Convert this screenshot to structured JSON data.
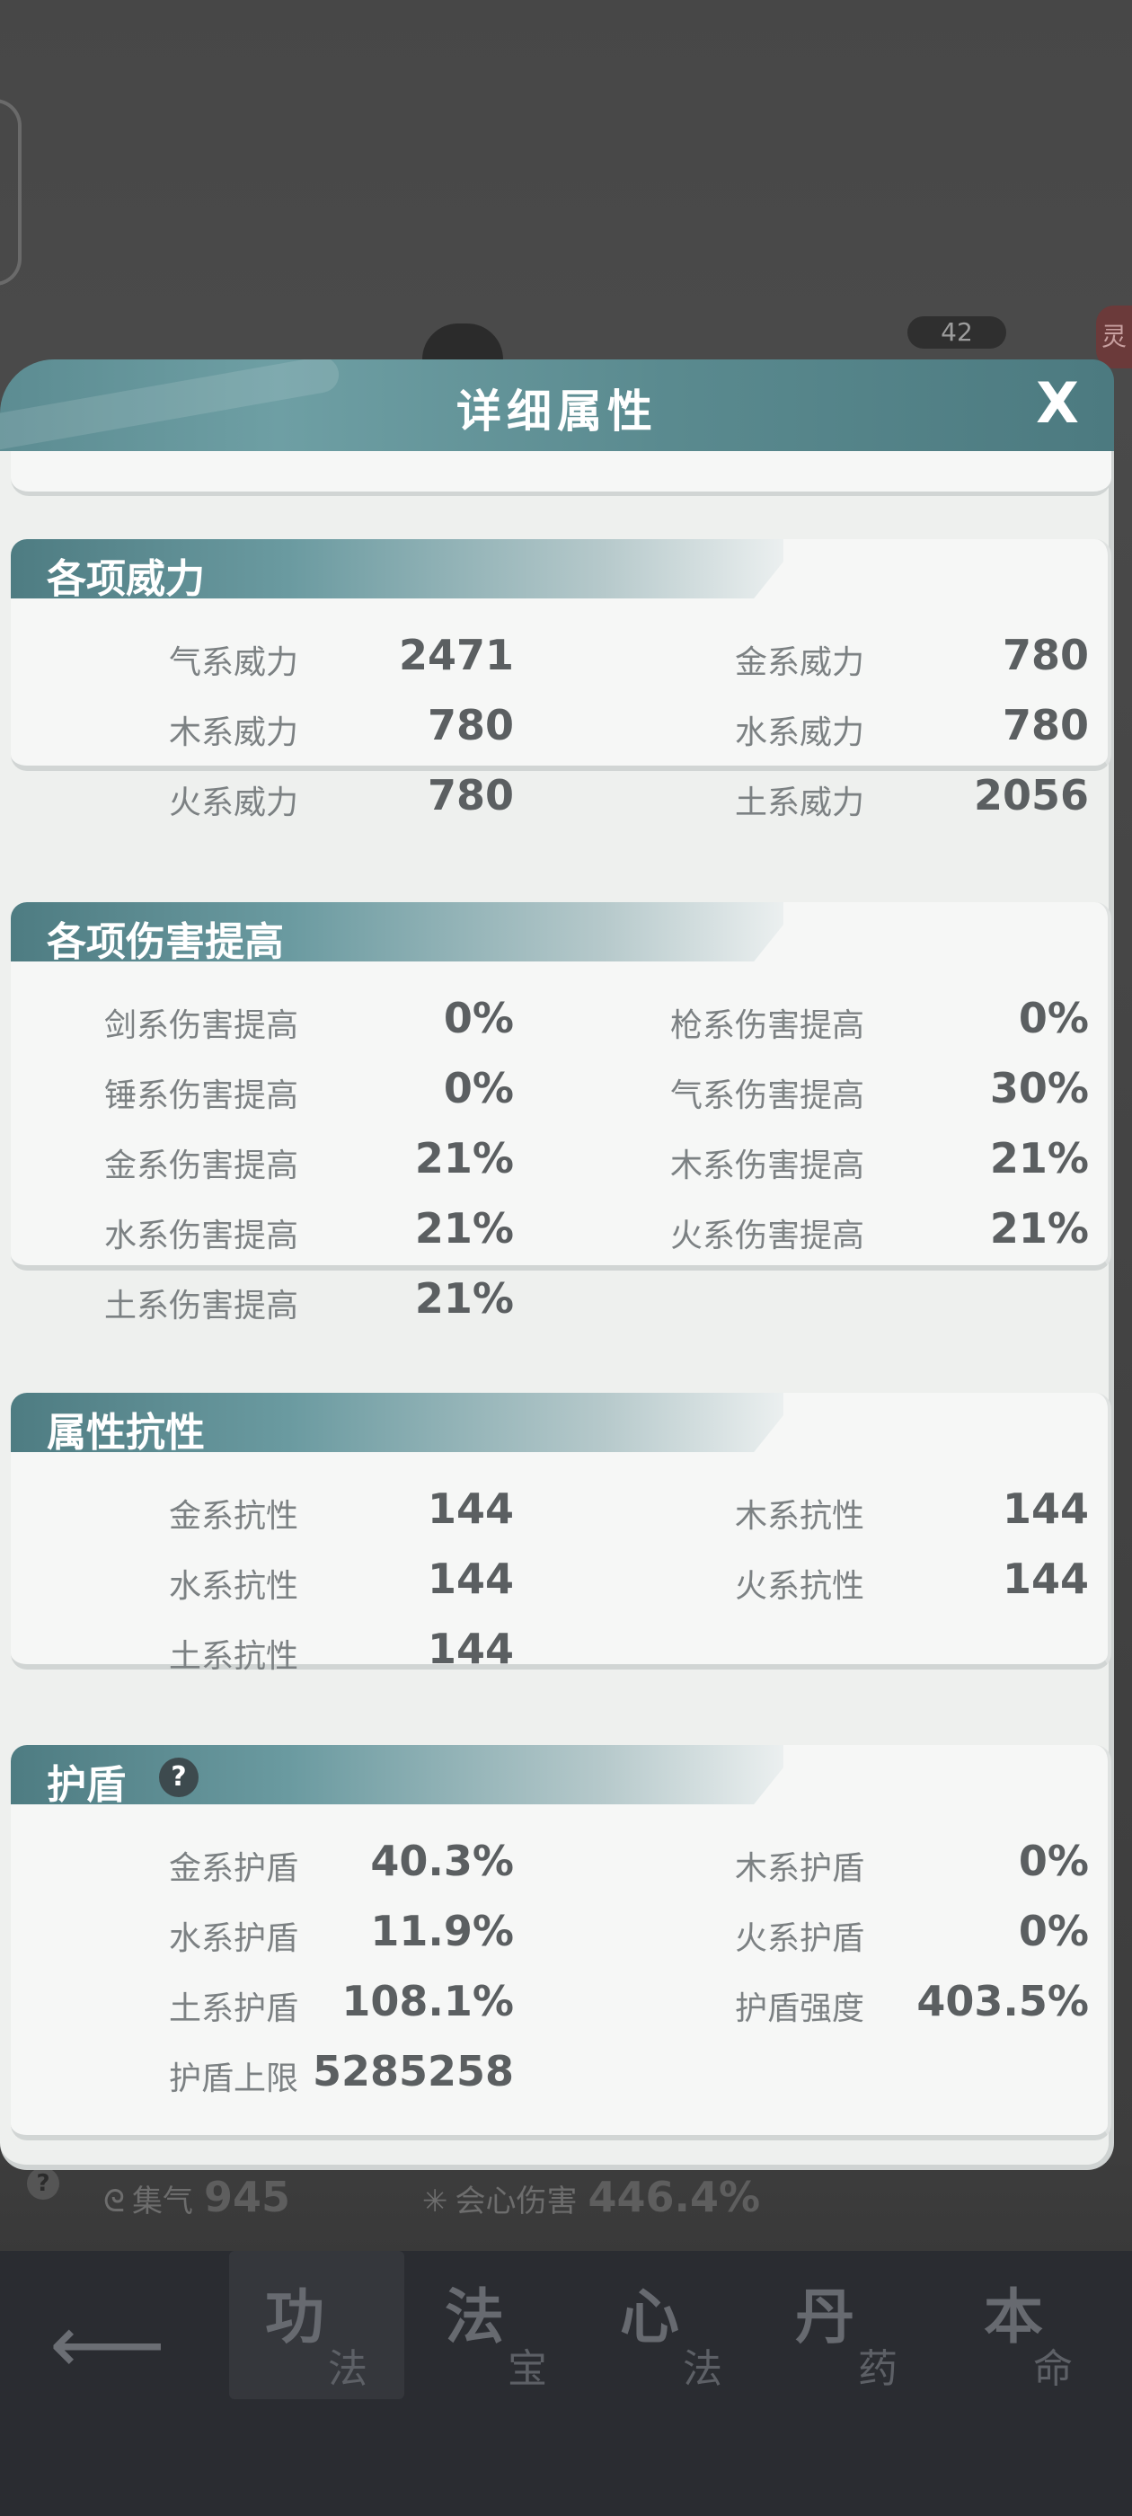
{
  "panel": {
    "title": "详细属性",
    "close_label": "X"
  },
  "background": {
    "level": "42",
    "side_tag": "灵",
    "stats": [
      {
        "label": "集气",
        "value": "945"
      },
      {
        "label": "会心伤害",
        "value": "446.4%"
      }
    ],
    "help_label": "?"
  },
  "sections": {
    "power": {
      "title": "各项威力",
      "rows": [
        [
          {
            "label": "气系威力",
            "value": "2471"
          },
          {
            "label": "金系威力",
            "value": "780"
          }
        ],
        [
          {
            "label": "木系威力",
            "value": "780"
          },
          {
            "label": "水系威力",
            "value": "780"
          }
        ],
        [
          {
            "label": "火系威力",
            "value": "780"
          },
          {
            "label": "土系威力",
            "value": "2056"
          }
        ]
      ]
    },
    "damage": {
      "title": "各项伤害提高",
      "rows": [
        [
          {
            "label": "剑系伤害提高",
            "value": "0%"
          },
          {
            "label": "枪系伤害提高",
            "value": "0%"
          }
        ],
        [
          {
            "label": "锤系伤害提高",
            "value": "0%"
          },
          {
            "label": "气系伤害提高",
            "value": "30%"
          }
        ],
        [
          {
            "label": "金系伤害提高",
            "value": "21%"
          },
          {
            "label": "木系伤害提高",
            "value": "21%"
          }
        ],
        [
          {
            "label": "水系伤害提高",
            "value": "21%"
          },
          {
            "label": "火系伤害提高",
            "value": "21%"
          }
        ],
        [
          {
            "label": "土系伤害提高",
            "value": "21%"
          }
        ]
      ]
    },
    "resist": {
      "title": "属性抗性",
      "rows": [
        [
          {
            "label": "金系抗性",
            "value": "144"
          },
          {
            "label": "木系抗性",
            "value": "144"
          }
        ],
        [
          {
            "label": "水系抗性",
            "value": "144"
          },
          {
            "label": "火系抗性",
            "value": "144"
          }
        ],
        [
          {
            "label": "土系抗性",
            "value": "144"
          }
        ]
      ]
    },
    "shield": {
      "title": "护盾",
      "help_label": "?",
      "rows": [
        [
          {
            "label": "金系护盾",
            "value": "40.3%"
          },
          {
            "label": "木系护盾",
            "value": "0%"
          }
        ],
        [
          {
            "label": "水系护盾",
            "value": "11.9%"
          },
          {
            "label": "火系护盾",
            "value": "0%"
          }
        ],
        [
          {
            "label": "土系护盾",
            "value": "108.1%"
          },
          {
            "label": "护盾强度",
            "value": "403.5%"
          }
        ],
        [
          {
            "label": "护盾上限",
            "value": "5285258"
          }
        ]
      ]
    }
  },
  "nav": {
    "back_icon": "back-arrow-icon",
    "tabs": [
      {
        "big": "功",
        "small": "法",
        "active": true
      },
      {
        "big": "法",
        "small": "宝",
        "active": false
      },
      {
        "big": "心",
        "small": "法",
        "active": false
      },
      {
        "big": "丹",
        "small": "药",
        "active": false
      },
      {
        "big": "本",
        "small": "命",
        "active": false
      }
    ]
  }
}
